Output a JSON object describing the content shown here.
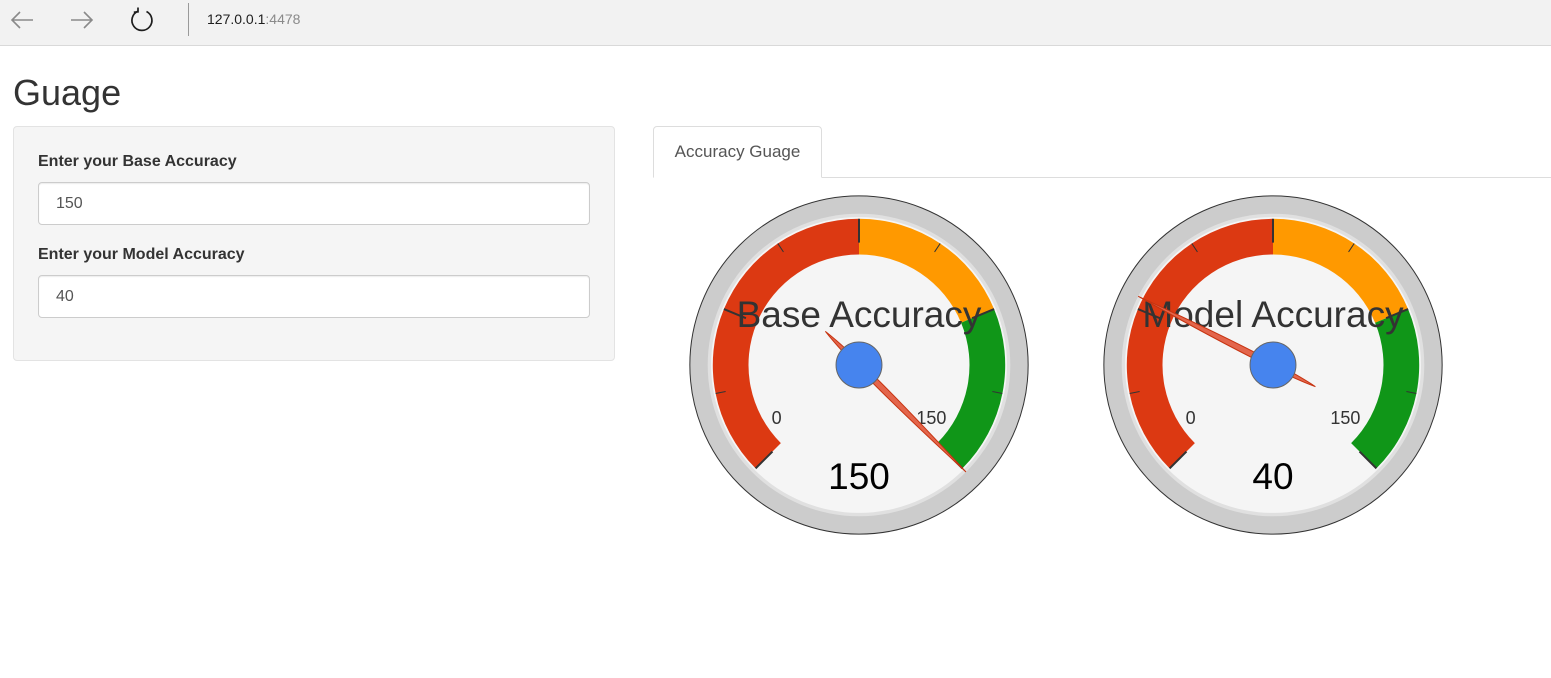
{
  "browser": {
    "url_host": "127.0.0.1",
    "url_port": ":4478",
    "icons": [
      "back-arrow-icon",
      "forward-arrow-icon",
      "reload-icon"
    ]
  },
  "page": {
    "title": "Guage"
  },
  "sidebar": {
    "base_label": "Enter your Base Accuracy",
    "base_value": "150",
    "model_label": "Enter your Model Accuracy",
    "model_value": "40"
  },
  "tabs": {
    "active_label": "Accuracy Guage"
  },
  "gauges": [
    {
      "label": "Base Accuracy",
      "value": 150,
      "value_text": "150",
      "min": 0,
      "max": 150,
      "min_text": "0",
      "max_text": "150",
      "bands": [
        {
          "from": 0,
          "to": 75,
          "color": "#dc3912"
        },
        {
          "from": 75,
          "to": 112.5,
          "color": "#ff9900"
        },
        {
          "from": 112.5,
          "to": 150,
          "color": "#109618"
        }
      ]
    },
    {
      "label": "Model Accuracy",
      "value": 40,
      "value_text": "40",
      "min": 0,
      "max": 150,
      "min_text": "0",
      "max_text": "150",
      "bands": [
        {
          "from": 0,
          "to": 75,
          "color": "#dc3912"
        },
        {
          "from": 75,
          "to": 112.5,
          "color": "#ff9900"
        },
        {
          "from": 112.5,
          "to": 150,
          "color": "#109618"
        }
      ]
    }
  ],
  "colors": {
    "needle": "#e3654b",
    "hub": "#4684ee",
    "bezel": "#cccccc",
    "face": "#f5f5f5"
  }
}
